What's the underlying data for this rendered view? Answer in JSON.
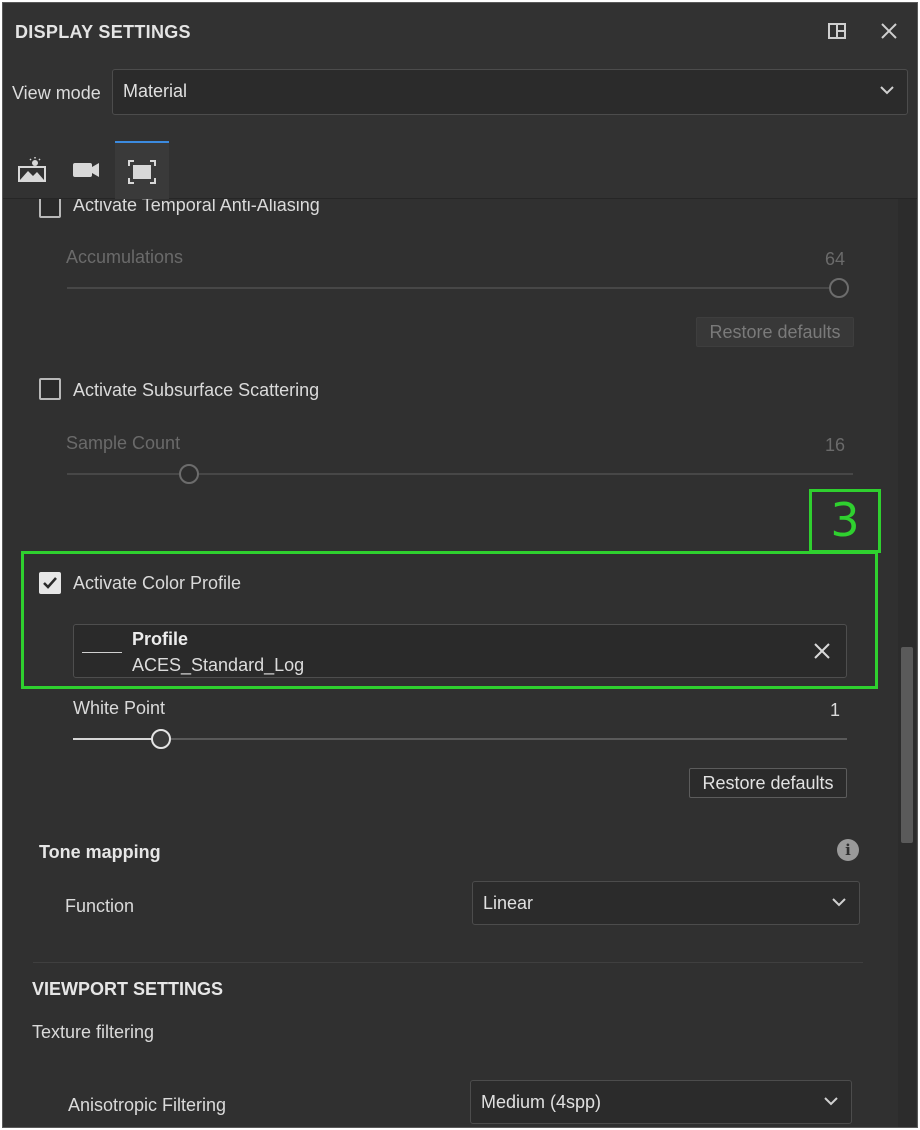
{
  "header": {
    "title": "DISPLAY SETTINGS",
    "dock_icon": "dock-panel-icon",
    "close_icon": "close-icon"
  },
  "view_mode": {
    "label": "View mode",
    "value": "Material"
  },
  "tabs": [
    {
      "icon": "environment-icon",
      "active": false
    },
    {
      "icon": "camera-icon",
      "active": false
    },
    {
      "icon": "viewport-frame-icon",
      "active": true
    }
  ],
  "taa": {
    "label": "Activate Temporal Anti-Aliasing",
    "checked": false,
    "accumulations_label": "Accumulations",
    "accumulations_value": "64",
    "restore_label": "Restore defaults"
  },
  "sss": {
    "label": "Activate Subsurface Scattering",
    "checked": false,
    "sample_label": "Sample Count",
    "sample_value": "16"
  },
  "annotation": {
    "number": "3",
    "color": "#2fd02f"
  },
  "color_profile": {
    "label": "Activate Color Profile",
    "checked": true,
    "profile_title": "Profile",
    "profile_value": "ACES_Standard_Log",
    "white_point_label": "White Point",
    "white_point_value": "1",
    "restore_label": "Restore defaults"
  },
  "tone_mapping": {
    "title": "Tone mapping",
    "function_label": "Function",
    "function_value": "Linear"
  },
  "viewport": {
    "title": "VIEWPORT SETTINGS",
    "texture_label": "Texture filtering",
    "aniso_label": "Anisotropic Filtering",
    "aniso_value": "Medium (4spp)"
  }
}
